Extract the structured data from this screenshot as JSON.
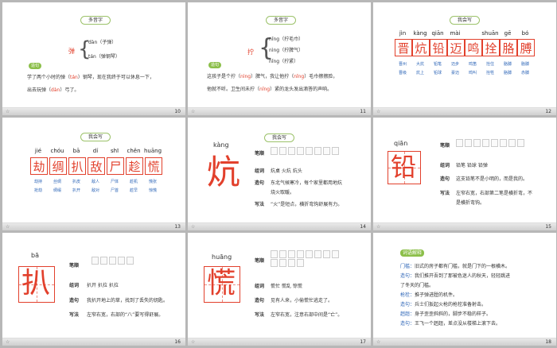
{
  "slides": [
    {
      "num": "10",
      "title": "多音字",
      "char": "弹",
      "readings": [
        "dàn（子弹）",
        "tán（弹钢琴）"
      ],
      "tag": "造句",
      "sentence_line1_a": "学了两个小时的弹（",
      "sentence_line1_py": "tán",
      "sentence_line1_b": "）钢琴，现在我终于可以休息一下，",
      "sentence_line2_a": "出去玩弹（",
      "sentence_line2_py": "dàn",
      "sentence_line2_b": "）弓了。"
    },
    {
      "num": "11",
      "title": "多音字",
      "char": "拧",
      "readings": [
        "nǐng（拧毛巾）",
        "nìng（拧脾气）",
        "nǐng（拧紧）"
      ],
      "tag": "造句",
      "sentence_line1_a": "这孩子是个拧（",
      "sentence_line1_py1": "nìng",
      "sentence_line1_b": "）脾气，我让他拧（",
      "sentence_line1_py2": "nǐng",
      "sentence_line1_c": "）毛巾擦擦脸，",
      "sentence_line2_a": "他就不听。卫生间未拧（",
      "sentence_line2_py": "nǐng",
      "sentence_line2_b": "）紧的龙头发出滴答的声响。"
    },
    {
      "num": "12",
      "title": "我会写",
      "pinyin": [
        "jìn",
        "kàng",
        "qiān",
        "mài",
        "",
        "shuān",
        "gē",
        "bó"
      ],
      "chars": [
        "晋",
        "炕",
        "铅",
        "迈",
        "鸣",
        "拴",
        "胳",
        "膊"
      ],
      "words1": [
        "晋州",
        "大炕",
        "铅笔",
        "迈步",
        "鸣笛",
        "拴住",
        "胳膊",
        "胳膊"
      ],
      "words2": [
        "晋级",
        "炕上",
        "铅球",
        "豪迈",
        "鸣叫",
        "拴牲",
        "胳膊",
        "赤膊"
      ]
    },
    {
      "num": "13",
      "title": "我会写",
      "pinyin": [
        "jié",
        "chóu",
        "bā",
        "dí",
        "shī",
        "chěn",
        "huāng"
      ],
      "chars": [
        "劫",
        "绸",
        "扒",
        "敌",
        "尸",
        "趁",
        "慌"
      ],
      "words1": [
        "劫持",
        "丝绸",
        "扒皮",
        "敌人",
        "尸体",
        "趁机",
        "慌张"
      ],
      "words2": [
        "抢劫",
        "绸缎",
        "扒开",
        "敌对",
        "尸首",
        "趁早",
        "惊慌"
      ]
    },
    {
      "num": "14",
      "title": "我会写",
      "pinyin": "kàng",
      "char": "炕",
      "labels": {
        "strokes": "笔顺",
        "words": "组词",
        "sentence": "造句",
        "writing": "写法"
      },
      "words": "炕桌   火炕   炕头",
      "sentence_1": "东北气候寒冷，每个家里都用地炕",
      "sentence_2": "烧火取暖。",
      "writing": "“火”是短点，横折弯钩舒展有力。"
    },
    {
      "num": "15",
      "pinyin": "qiān",
      "char": "铅",
      "labels": {
        "strokes": "笔顺",
        "words": "组词",
        "sentence": "造句",
        "writing": "写法"
      },
      "words": "铅笔   铅球   铅弹",
      "sentence": "这支铅笔不是小明的，而是我的。",
      "writing_1": "左窄右宽，右部第二笔是横折弯，不",
      "writing_2": "是横折弯钩。"
    },
    {
      "num": "16",
      "pinyin": "bā",
      "char": "扒",
      "labels": {
        "strokes": "笔顺",
        "words": "组词",
        "sentence": "造句",
        "writing": "写法"
      },
      "words": "扒开   扒拉   扒拉",
      "sentence": "我扒开地上的草，找到了丢失的钥匙。",
      "writing": "左窄右宽，右部的“八”要写得舒展。"
    },
    {
      "num": "17",
      "pinyin": "huāng",
      "char": "慌",
      "labels": {
        "strokes": "笔顺",
        "words": "组词",
        "sentence": "造句",
        "writing": "写法"
      },
      "words": "慌忙   慌乱   惊慌",
      "sentence": "见有人来，小偷慌忙逃走了。",
      "writing": "左窄右宽，注意右部中间是“亡”。"
    },
    {
      "num": "18",
      "title": "词语解释",
      "items": [
        {
          "term": "门槛：",
          "text": "旧式的房子都有门槛，就是门下的一根横木。"
        },
        {
          "term": "造句：",
          "text": "我们推开吾到了那被色迷人的秋天，轻轻跳进"
        },
        {
          "term": "",
          "text": "了冬天的门槛。"
        },
        {
          "term": "枪栓：",
          "text": "推子弹进膛的机件。"
        },
        {
          "term": "造句：",
          "text": "兵士们扳起火枪的枪栓准备射击。"
        },
        {
          "term": "趔趄：",
          "text": "身子歪歪斜斜的，脚步不稳的样子。"
        },
        {
          "term": "造句：",
          "text": "王飞一个趔趄，差点没从楼梯上滚下去。"
        }
      ]
    }
  ],
  "footer_star": "☆"
}
